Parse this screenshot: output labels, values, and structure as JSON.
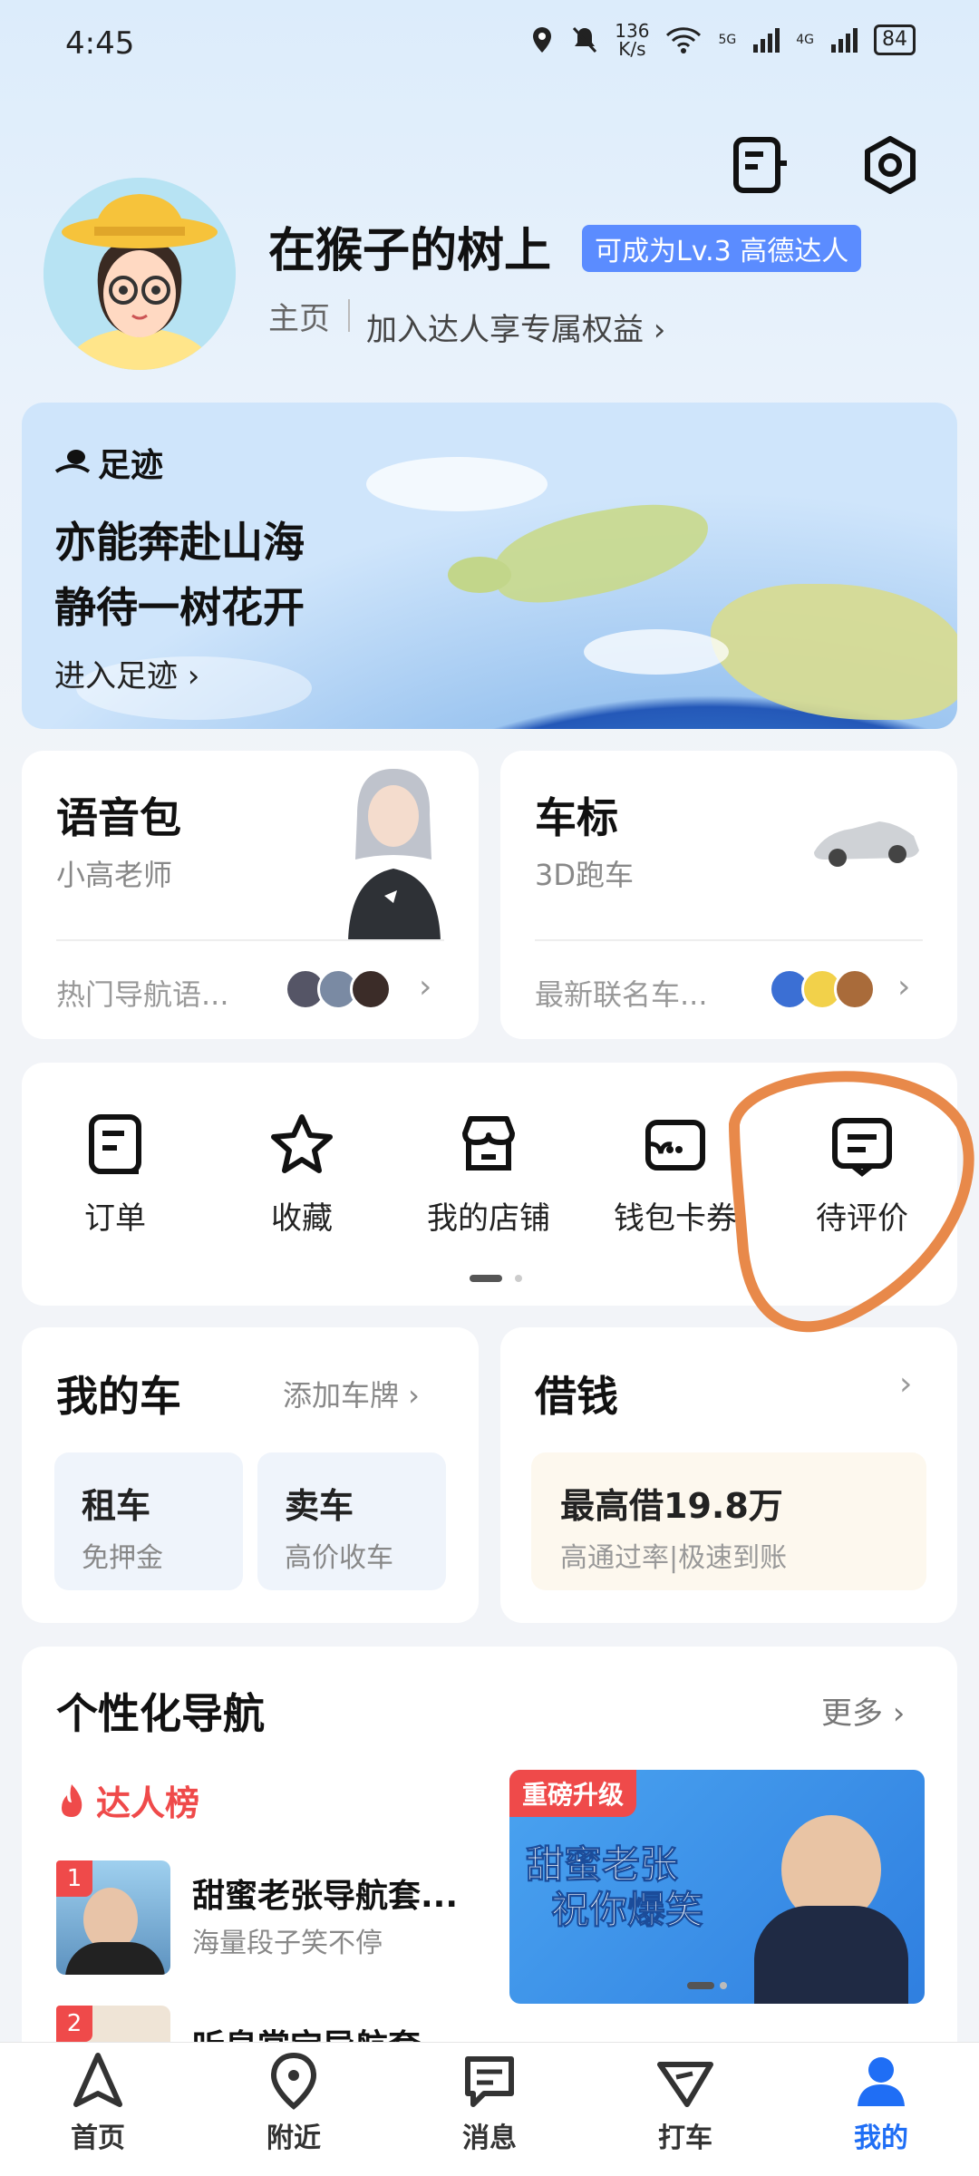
{
  "status_bar": {
    "time": "4:45",
    "net_speed_value": "136",
    "net_speed_unit": "K/s",
    "sig1": "5G",
    "sig2": "4G",
    "battery": "84"
  },
  "profile": {
    "username": "在猴子的树上",
    "level_badge": "可成为Lv.3 高德达人",
    "homepage_link": "主页",
    "join_link": "加入达人享专属权益 ›"
  },
  "footprint": {
    "label": "足迹",
    "title_line1": "亦能奔赴山海",
    "title_line2": "静待一树花开",
    "enter_link": "进入足迹 ›"
  },
  "voice_pack": {
    "title": "语音包",
    "subtitle": "小高老师",
    "footer": "热门导航语..."
  },
  "car_logo": {
    "title": "车标",
    "subtitle": "3D跑车",
    "footer": "最新联名车..."
  },
  "tools": [
    {
      "label": "订单",
      "icon": "order-icon"
    },
    {
      "label": "收藏",
      "icon": "star-icon"
    },
    {
      "label": "我的店铺",
      "icon": "shop-icon"
    },
    {
      "label": "钱包卡券",
      "icon": "wallet-icon"
    },
    {
      "label": "待评价",
      "icon": "review-icon"
    }
  ],
  "my_car": {
    "title": "我的车",
    "add_plate": "添加车牌 ›",
    "rent_title": "租车",
    "rent_sub": "免押金",
    "sell_title": "卖车",
    "sell_sub": "高价收车"
  },
  "loan": {
    "title": "借钱",
    "amount": "最高借19.8万",
    "desc": "高通过率|极速到账"
  },
  "personal_nav": {
    "title": "个性化导航",
    "more": "更多 ›",
    "ranking_label": "达人榜",
    "items": [
      {
        "rank": "1",
        "name": "甜蜜老张导航套...",
        "desc": "海量段子笑不停"
      },
      {
        "rank": "2",
        "name": "听泉赏宝导航套...",
        "desc": ""
      }
    ],
    "promo_tag": "重磅升级",
    "promo_line1": "甜蜜老张",
    "promo_line2": "祝你爆笑"
  },
  "tabbar": [
    {
      "label": "首页",
      "icon": "home-nav-icon"
    },
    {
      "label": "附近",
      "icon": "location-pin-icon"
    },
    {
      "label": "消息",
      "icon": "message-icon"
    },
    {
      "label": "打车",
      "icon": "taxi-icon"
    },
    {
      "label": "我的",
      "icon": "profile-icon"
    }
  ],
  "colors": {
    "accent": "#1f6ef5",
    "badge": "#5b8cff",
    "rank_red": "#ef4a4a",
    "annotation": "#e8894a"
  }
}
